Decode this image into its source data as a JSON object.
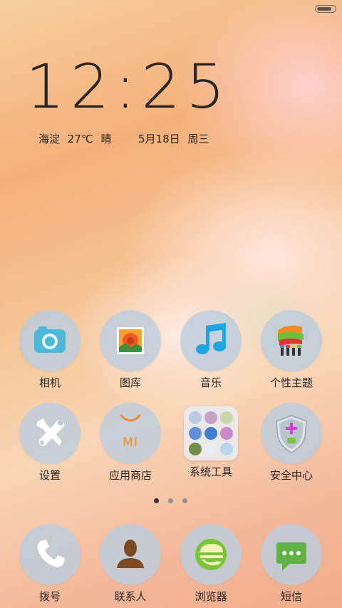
{
  "status_bar": {
    "battery_level": 0.85
  },
  "clock": {
    "time": "12:25"
  },
  "weather": {
    "location": "海淀",
    "temperature": "27℃",
    "condition": "晴"
  },
  "date": {
    "date": "5月18日",
    "weekday": "周三"
  },
  "apps_row1": [
    {
      "label": "相机",
      "icon": "camera-icon"
    },
    {
      "label": "图库",
      "icon": "gallery-icon"
    },
    {
      "label": "音乐",
      "icon": "music-icon"
    },
    {
      "label": "个性主题",
      "icon": "themes-icon"
    }
  ],
  "apps_row2": [
    {
      "label": "设置",
      "icon": "settings-icon"
    },
    {
      "label": "应用商店",
      "icon": "app-store-icon",
      "logo_text": "MI"
    },
    {
      "label": "系统工具",
      "icon": "folder-icon",
      "folder_items": [
        "weather-icon",
        "compass-icon",
        "notes-icon",
        "cloud-icon",
        "recorder-icon",
        "nfc-icon",
        "scanner-icon",
        "video-icon",
        "battery-icon"
      ]
    },
    {
      "label": "安全中心",
      "icon": "security-icon"
    }
  ],
  "page_indicator": {
    "count": 3,
    "active": 0
  },
  "dock": [
    {
      "label": "拨号",
      "icon": "phone-icon"
    },
    {
      "label": "联系人",
      "icon": "contacts-icon"
    },
    {
      "label": "浏览器",
      "icon": "browser-icon"
    },
    {
      "label": "短信",
      "icon": "messages-icon"
    }
  ],
  "colors": {
    "accent_camera": "#4fb8d6",
    "accent_music": "#1ea5e0",
    "accent_browser": "#7ac43a",
    "accent_messages": "#5fb344"
  }
}
